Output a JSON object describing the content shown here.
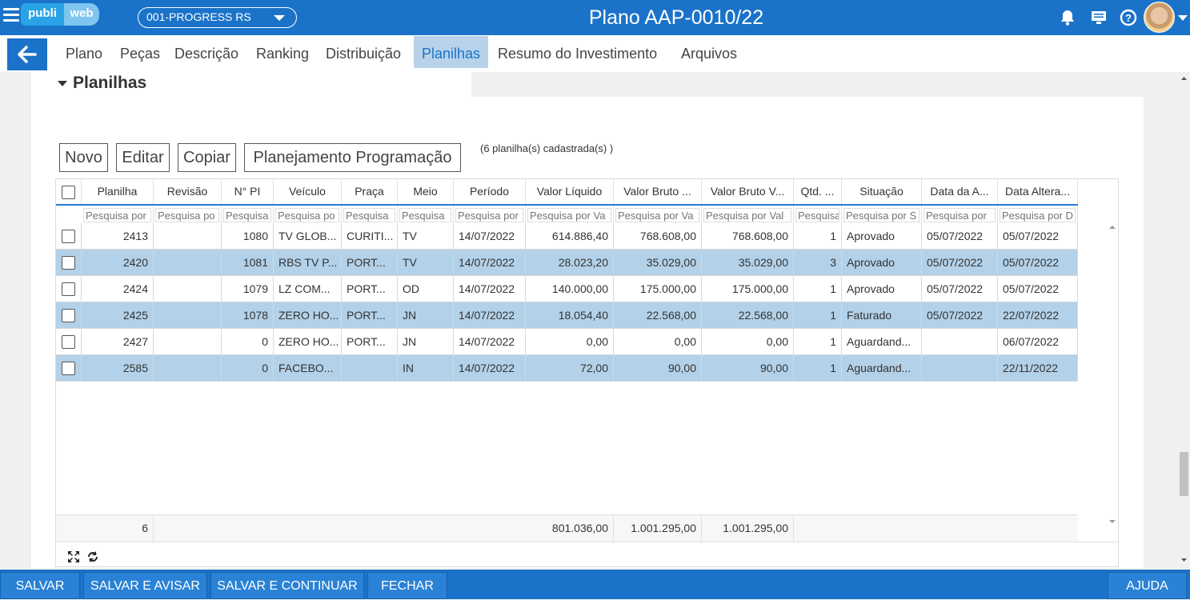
{
  "header": {
    "logo_left": "publi",
    "logo_right": "web",
    "selector_value": "001-PROGRESS RS",
    "title": "Plano AAP-0010/22"
  },
  "tabs": [
    "Plano",
    "Peças",
    "Descrição",
    "Ranking",
    "Distribuição",
    "Planilhas",
    "Resumo do Investimento",
    "Arquivos"
  ],
  "active_tab": "Planilhas",
  "section_title": "Planilhas",
  "toolbar": {
    "novo": "Novo",
    "editar": "Editar",
    "copiar": "Copiar",
    "planejamento": "Planejamento Programação"
  },
  "count_text": "(6   planilha(s) cadastrada(s) )",
  "grid": {
    "columns": [
      "Planilha",
      "Revisão",
      "N° PI",
      "Veículo",
      "Praça",
      "Meio",
      "Período",
      "Valor Líquido",
      "Valor Bruto ...",
      "Valor Bruto V...",
      "Qtd. ...",
      "Situação",
      "Data da A...",
      "Data Altera..."
    ],
    "filter_placeholders": [
      "Pesquisa por",
      "Pesquisa po",
      "Pesquisa",
      "Pesquisa po",
      "Pesquisa",
      "Pesquisa",
      "Pesquisa por",
      "Pesquisa por Va",
      "Pesquisa por Va",
      "Pesquisa por Val",
      "Pesquisa",
      "Pesquisa por S",
      "Pesquisa por",
      "Pesquisa por D"
    ],
    "rows": [
      [
        "2413",
        "",
        "1080",
        "TV GLOB...",
        "CURITI...",
        "TV",
        "14/07/2022",
        "614.886,40",
        "768.608,00",
        "768.608,00",
        "1",
        "Aprovado",
        "05/07/2022",
        "05/07/2022"
      ],
      [
        "2420",
        "",
        "1081",
        "RBS TV P...",
        "PORT...",
        "TV",
        "14/07/2022",
        "28.023,20",
        "35.029,00",
        "35.029,00",
        "3",
        "Aprovado",
        "05/07/2022",
        "05/07/2022"
      ],
      [
        "2424",
        "",
        "1079",
        "LZ COM...",
        "PORT...",
        "OD",
        "14/07/2022",
        "140.000,00",
        "175.000,00",
        "175.000,00",
        "1",
        "Aprovado",
        "05/07/2022",
        "05/07/2022"
      ],
      [
        "2425",
        "",
        "1078",
        "ZERO HO...",
        "PORT...",
        "JN",
        "14/07/2022",
        "18.054,40",
        "22.568,00",
        "22.568,00",
        "1",
        "Faturado",
        "05/07/2022",
        "22/07/2022"
      ],
      [
        "2427",
        "",
        "0",
        "ZERO HO...",
        "PORT...",
        "JN",
        "14/07/2022",
        "0,00",
        "0,00",
        "0,00",
        "1",
        "Aguardand...",
        "",
        "06/07/2022"
      ],
      [
        "2585",
        "",
        "0",
        "FACEBO...",
        "",
        "IN",
        "14/07/2022",
        "72,00",
        "90,00",
        "90,00",
        "1",
        "Aguardand...",
        "",
        "22/11/2022"
      ]
    ],
    "footer": {
      "count": "6",
      "valor_liquido": "801.036,00",
      "valor_bruto": "1.001.295,00",
      "valor_bruto_v": "1.001.295,00"
    }
  },
  "bottom": {
    "salvar": "SALVAR",
    "salvar_avisar": "SALVAR E AVISAR",
    "salvar_continuar": "SALVAR E CONTINUAR",
    "fechar": "FECHAR",
    "ajuda": "AJUDA"
  },
  "colors": {
    "primary": "#1a73c9",
    "row_alt": "#b3d1e8",
    "active_tab_bg": "#b8d2ea"
  }
}
